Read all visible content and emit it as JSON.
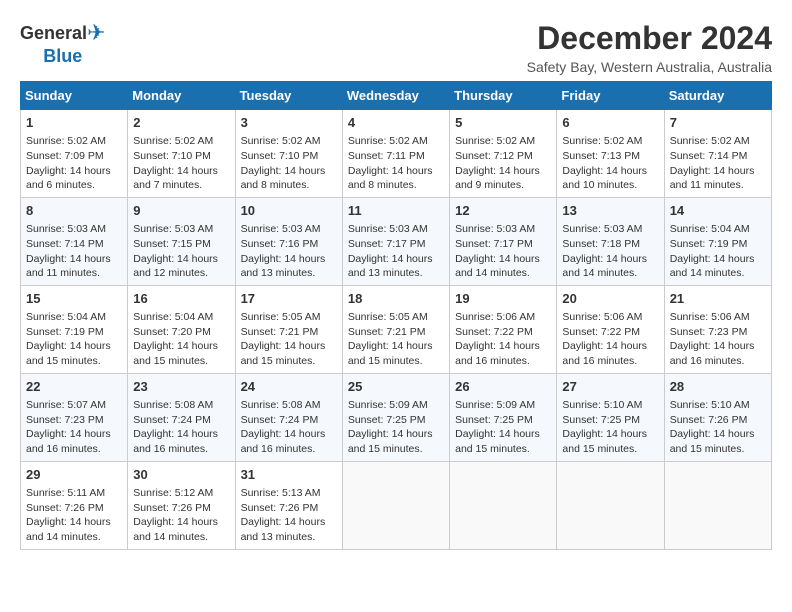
{
  "logo": {
    "general": "General",
    "blue": "Blue"
  },
  "title": "December 2024",
  "subtitle": "Safety Bay, Western Australia, Australia",
  "days_of_week": [
    "Sunday",
    "Monday",
    "Tuesday",
    "Wednesday",
    "Thursday",
    "Friday",
    "Saturday"
  ],
  "weeks": [
    [
      {
        "day": 1,
        "lines": [
          "Sunrise: 5:02 AM",
          "Sunset: 7:09 PM",
          "Daylight: 14 hours",
          "and 6 minutes."
        ]
      },
      {
        "day": 2,
        "lines": [
          "Sunrise: 5:02 AM",
          "Sunset: 7:10 PM",
          "Daylight: 14 hours",
          "and 7 minutes."
        ]
      },
      {
        "day": 3,
        "lines": [
          "Sunrise: 5:02 AM",
          "Sunset: 7:10 PM",
          "Daylight: 14 hours",
          "and 8 minutes."
        ]
      },
      {
        "day": 4,
        "lines": [
          "Sunrise: 5:02 AM",
          "Sunset: 7:11 PM",
          "Daylight: 14 hours",
          "and 8 minutes."
        ]
      },
      {
        "day": 5,
        "lines": [
          "Sunrise: 5:02 AM",
          "Sunset: 7:12 PM",
          "Daylight: 14 hours",
          "and 9 minutes."
        ]
      },
      {
        "day": 6,
        "lines": [
          "Sunrise: 5:02 AM",
          "Sunset: 7:13 PM",
          "Daylight: 14 hours",
          "and 10 minutes."
        ]
      },
      {
        "day": 7,
        "lines": [
          "Sunrise: 5:02 AM",
          "Sunset: 7:14 PM",
          "Daylight: 14 hours",
          "and 11 minutes."
        ]
      }
    ],
    [
      {
        "day": 8,
        "lines": [
          "Sunrise: 5:03 AM",
          "Sunset: 7:14 PM",
          "Daylight: 14 hours",
          "and 11 minutes."
        ]
      },
      {
        "day": 9,
        "lines": [
          "Sunrise: 5:03 AM",
          "Sunset: 7:15 PM",
          "Daylight: 14 hours",
          "and 12 minutes."
        ]
      },
      {
        "day": 10,
        "lines": [
          "Sunrise: 5:03 AM",
          "Sunset: 7:16 PM",
          "Daylight: 14 hours",
          "and 13 minutes."
        ]
      },
      {
        "day": 11,
        "lines": [
          "Sunrise: 5:03 AM",
          "Sunset: 7:17 PM",
          "Daylight: 14 hours",
          "and 13 minutes."
        ]
      },
      {
        "day": 12,
        "lines": [
          "Sunrise: 5:03 AM",
          "Sunset: 7:17 PM",
          "Daylight: 14 hours",
          "and 14 minutes."
        ]
      },
      {
        "day": 13,
        "lines": [
          "Sunrise: 5:03 AM",
          "Sunset: 7:18 PM",
          "Daylight: 14 hours",
          "and 14 minutes."
        ]
      },
      {
        "day": 14,
        "lines": [
          "Sunrise: 5:04 AM",
          "Sunset: 7:19 PM",
          "Daylight: 14 hours",
          "and 14 minutes."
        ]
      }
    ],
    [
      {
        "day": 15,
        "lines": [
          "Sunrise: 5:04 AM",
          "Sunset: 7:19 PM",
          "Daylight: 14 hours",
          "and 15 minutes."
        ]
      },
      {
        "day": 16,
        "lines": [
          "Sunrise: 5:04 AM",
          "Sunset: 7:20 PM",
          "Daylight: 14 hours",
          "and 15 minutes."
        ]
      },
      {
        "day": 17,
        "lines": [
          "Sunrise: 5:05 AM",
          "Sunset: 7:21 PM",
          "Daylight: 14 hours",
          "and 15 minutes."
        ]
      },
      {
        "day": 18,
        "lines": [
          "Sunrise: 5:05 AM",
          "Sunset: 7:21 PM",
          "Daylight: 14 hours",
          "and 15 minutes."
        ]
      },
      {
        "day": 19,
        "lines": [
          "Sunrise: 5:06 AM",
          "Sunset: 7:22 PM",
          "Daylight: 14 hours",
          "and 16 minutes."
        ]
      },
      {
        "day": 20,
        "lines": [
          "Sunrise: 5:06 AM",
          "Sunset: 7:22 PM",
          "Daylight: 14 hours",
          "and 16 minutes."
        ]
      },
      {
        "day": 21,
        "lines": [
          "Sunrise: 5:06 AM",
          "Sunset: 7:23 PM",
          "Daylight: 14 hours",
          "and 16 minutes."
        ]
      }
    ],
    [
      {
        "day": 22,
        "lines": [
          "Sunrise: 5:07 AM",
          "Sunset: 7:23 PM",
          "Daylight: 14 hours",
          "and 16 minutes."
        ]
      },
      {
        "day": 23,
        "lines": [
          "Sunrise: 5:08 AM",
          "Sunset: 7:24 PM",
          "Daylight: 14 hours",
          "and 16 minutes."
        ]
      },
      {
        "day": 24,
        "lines": [
          "Sunrise: 5:08 AM",
          "Sunset: 7:24 PM",
          "Daylight: 14 hours",
          "and 16 minutes."
        ]
      },
      {
        "day": 25,
        "lines": [
          "Sunrise: 5:09 AM",
          "Sunset: 7:25 PM",
          "Daylight: 14 hours",
          "and 15 minutes."
        ]
      },
      {
        "day": 26,
        "lines": [
          "Sunrise: 5:09 AM",
          "Sunset: 7:25 PM",
          "Daylight: 14 hours",
          "and 15 minutes."
        ]
      },
      {
        "day": 27,
        "lines": [
          "Sunrise: 5:10 AM",
          "Sunset: 7:25 PM",
          "Daylight: 14 hours",
          "and 15 minutes."
        ]
      },
      {
        "day": 28,
        "lines": [
          "Sunrise: 5:10 AM",
          "Sunset: 7:26 PM",
          "Daylight: 14 hours",
          "and 15 minutes."
        ]
      }
    ],
    [
      {
        "day": 29,
        "lines": [
          "Sunrise: 5:11 AM",
          "Sunset: 7:26 PM",
          "Daylight: 14 hours",
          "and 14 minutes."
        ]
      },
      {
        "day": 30,
        "lines": [
          "Sunrise: 5:12 AM",
          "Sunset: 7:26 PM",
          "Daylight: 14 hours",
          "and 14 minutes."
        ]
      },
      {
        "day": 31,
        "lines": [
          "Sunrise: 5:13 AM",
          "Sunset: 7:26 PM",
          "Daylight: 14 hours",
          "and 13 minutes."
        ]
      },
      null,
      null,
      null,
      null
    ]
  ]
}
